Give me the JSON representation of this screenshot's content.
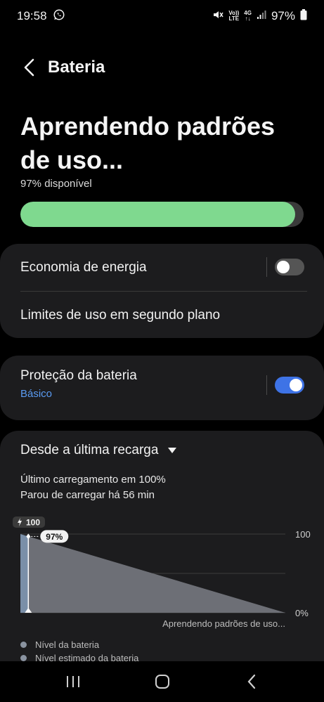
{
  "status": {
    "time": "19:58",
    "battery": "97%",
    "net_top": "Vo))",
    "net_bottom": "LTE",
    "signal_top": "4G",
    "signal_bottom": "↑↓"
  },
  "header": {
    "title": "Bateria"
  },
  "hero": {
    "title": "Aprendendo padrões de uso...",
    "subtitle": "97% disponível",
    "battery_level": 97,
    "fill_color": "#7fd98f"
  },
  "settings": {
    "power_saving": {
      "label": "Economia de energia",
      "enabled": false
    },
    "background_limits": {
      "label": "Limites de uso em segundo plano"
    },
    "battery_protection": {
      "label": "Proteção da bateria",
      "sub": "Básico",
      "enabled": true
    }
  },
  "usage": {
    "dropdown_label": "Desde a última recarga",
    "last_charge": "Último carregamento em 100%",
    "stopped": "Parou de carregar há 56 min",
    "legend": [
      "Nível da bateria",
      "Nível estimado da bateria"
    ]
  },
  "chart_data": {
    "type": "area",
    "charge_badge": "100",
    "current_label": "97%",
    "y_tick_labels": [
      "100",
      "0%"
    ],
    "ylim": [
      0,
      100
    ],
    "series": [
      {
        "name": "Nível da bateria",
        "x": [
          0,
          0.03
        ],
        "values": [
          100,
          97
        ]
      },
      {
        "name": "Nível estimado da bateria",
        "x": [
          0.03,
          1
        ],
        "values": [
          97,
          0
        ]
      }
    ],
    "annotation": "Aprendendo padrões de uso...",
    "grid": true
  },
  "nav": {
    "recent": "recent-apps",
    "home": "home",
    "back": "back"
  },
  "colors": {
    "accent": "#3e73e6",
    "link": "#5a9bf2",
    "battery": "#7fd98f"
  }
}
